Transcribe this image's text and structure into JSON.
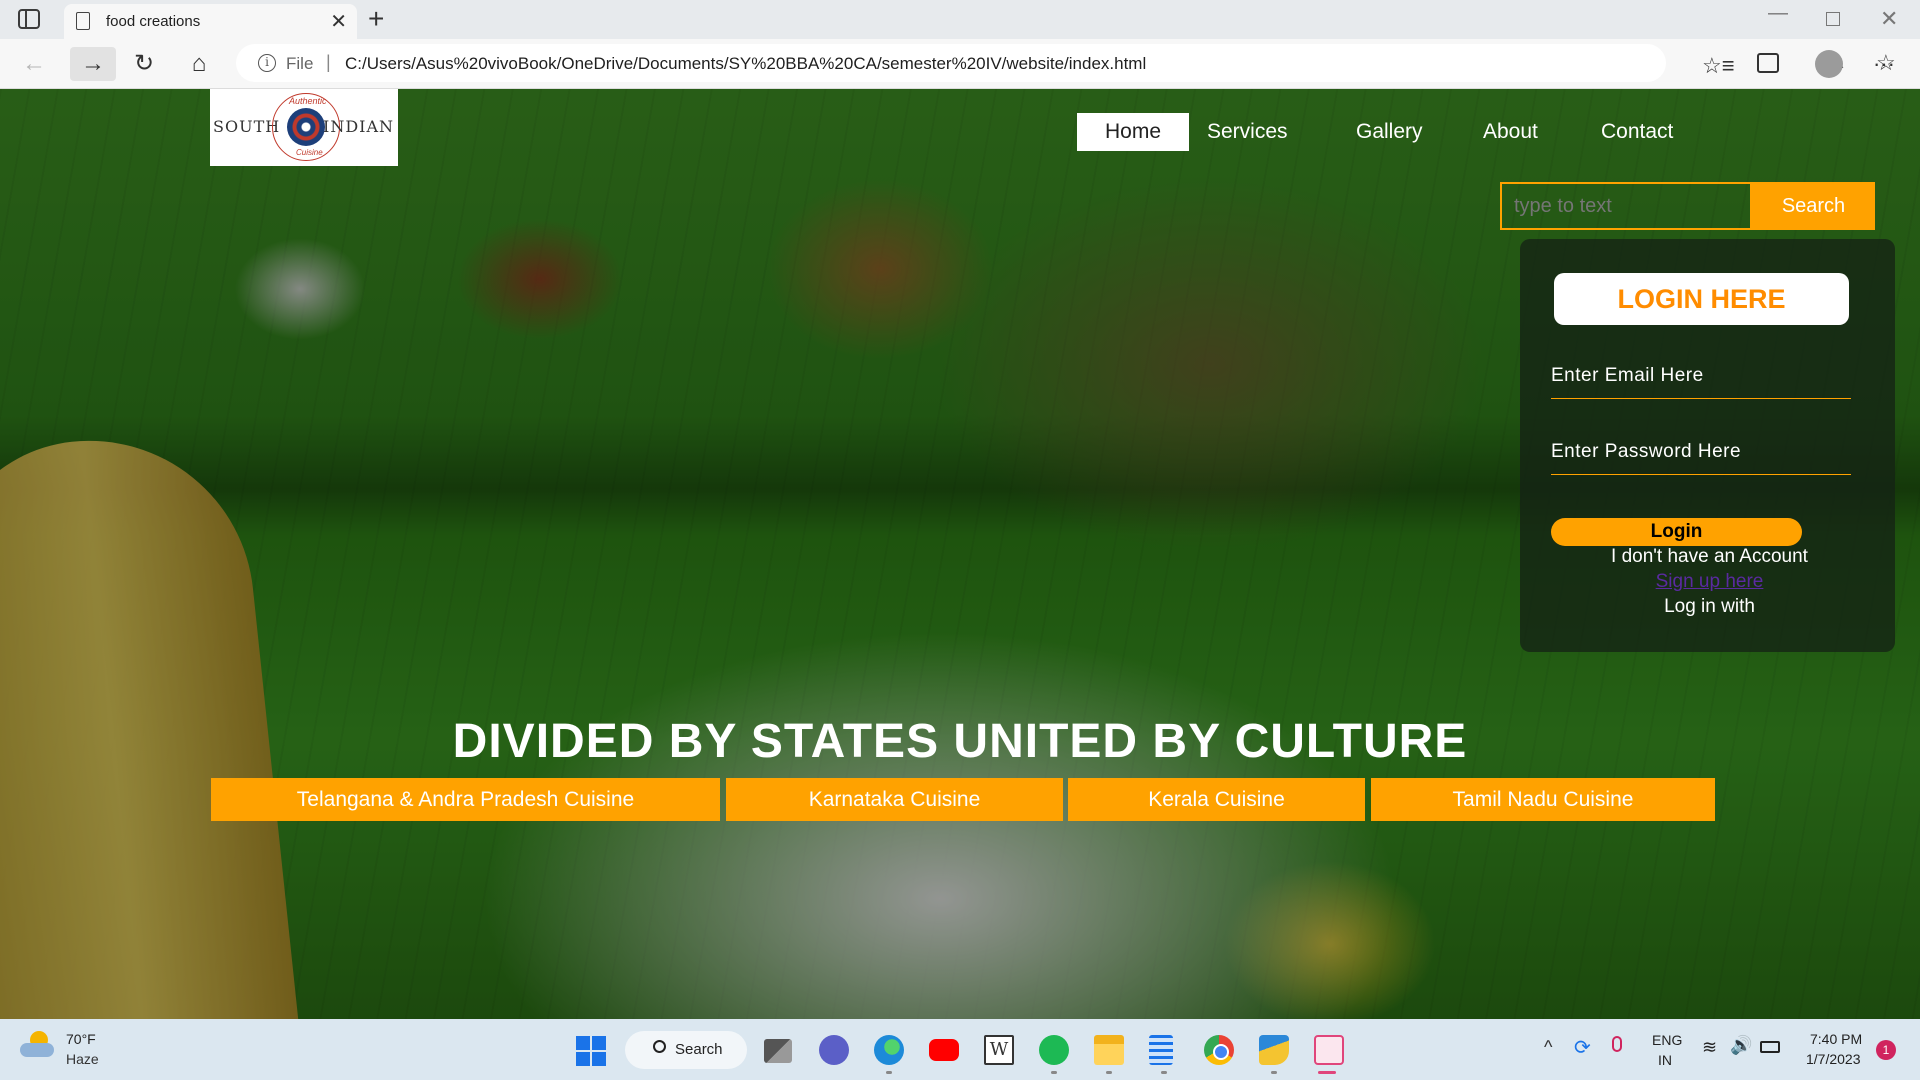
{
  "browser": {
    "tab": {
      "title": "food creations",
      "close": "✕"
    },
    "new_tab": "+",
    "window": {
      "minimize": "—",
      "close": "✕"
    },
    "nav": {
      "back": "←",
      "forward": "→",
      "reload": "↻",
      "home": "⌂"
    },
    "address": {
      "info_icon": "i",
      "scheme": "File",
      "separator": "|",
      "url": "C:/Users/Asus%20vivoBook/OneDrive/Documents/SY%20BBA%20CA/semester%20IV/website/index.html"
    },
    "toolbar": {
      "read_aloud": "À",
      "favorite_add": "☆",
      "favorites": "☆≡",
      "menu": "···"
    }
  },
  "site": {
    "logo": {
      "left": "SOUTH",
      "right": "INDIAN",
      "top": "Authentic",
      "bottom": "Cuisine"
    },
    "nav": [
      "Home",
      "Services",
      "Gallery",
      "About",
      "Contact"
    ],
    "search": {
      "placeholder": "type to text",
      "button": "Search"
    },
    "login": {
      "title": "LOGIN HERE",
      "email_placeholder": "Enter Email Here",
      "password_placeholder": "Enter Password Here",
      "button": "Login",
      "no_account": "I don't have an Account",
      "signup": "Sign up here",
      "login_with": "Log in with"
    },
    "tagline": "DIVIDED BY STATES UNITED BY CULTURE",
    "cuisines": [
      "Telangana & Andra Pradesh Cuisine",
      "Karnataka Cuisine",
      "Kerala Cuisine",
      "Tamil Nadu Cuisine"
    ],
    "colors": {
      "accent": "#ffa200",
      "login_title": "#ff8c00"
    }
  },
  "taskbar": {
    "weather": {
      "temp": "70°F",
      "desc": "Haze"
    },
    "search_label": "Search",
    "apps": [
      "task-view",
      "teams",
      "edge",
      "youtube",
      "word",
      "spotify",
      "file-explorer",
      "notepad",
      "chrome",
      "photos",
      "snipping-tool"
    ],
    "word_letter": "W",
    "tray": {
      "chevron": "^",
      "sync": "⟳",
      "lang_1": "ENG",
      "lang_2": "IN",
      "wifi": "≋",
      "volume": "🔊",
      "time": "7:40 PM",
      "date": "1/7/2023",
      "notifications": "1"
    }
  }
}
